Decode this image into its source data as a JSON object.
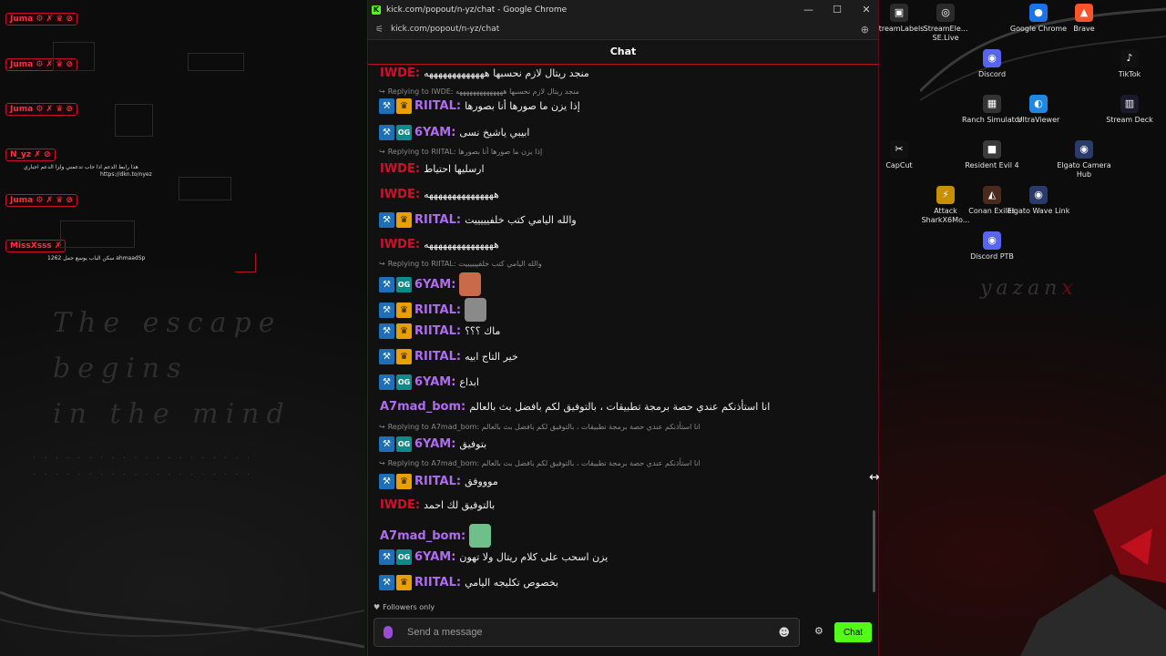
{
  "browser": {
    "window_title": "kick.com/popout/n-yz/chat - Google Chrome",
    "url": "kick.com/popout/n-yz/chat",
    "controls": {
      "minimize": "—",
      "maximize": "☐",
      "close": "✕"
    }
  },
  "chat": {
    "header": "Chat",
    "messages": [
      {
        "user": "IWDE",
        "color": "#d0102a",
        "badges": [],
        "text": "منجد ريتال لازم نحسبها هههههههههههههه"
      },
      {
        "reply": "Replying to IWDE: منجد ريتال لازم نحسبها ههههههههههههههه"
      },
      {
        "user": "RIITAL",
        "color": "#b06cf0",
        "badges": [
          "mod",
          "crown"
        ],
        "text": "إذا يزن ما صورها أنا بصورها"
      },
      {
        "user": "6YAM",
        "color": "#b06cf0",
        "badges": [
          "mod",
          "og"
        ],
        "text": "ابيبي ياشيخ نسى"
      },
      {
        "reply": "Replying to RIITAL: إذا يزن ما صورها أنا بصورها"
      },
      {
        "user": "IWDE",
        "color": "#d0102a",
        "badges": [],
        "text": "ارسليها احتياط"
      },
      {
        "user": "IWDE",
        "color": "#d0102a",
        "badges": [],
        "text": "هههههههههههههههه"
      },
      {
        "user": "RIITAL",
        "color": "#b06cf0",
        "badges": [
          "mod",
          "crown"
        ],
        "text": "والله اليامي كتب خلفيييييت"
      },
      {
        "user": "IWDE",
        "color": "#d0102a",
        "badges": [],
        "text": "هههههههههههههههه"
      },
      {
        "reply": "Replying to RIITAL: والله اليامي كتب خلفييييييت"
      },
      {
        "user": "6YAM",
        "color": "#b06cf0",
        "badges": [
          "mod",
          "og"
        ],
        "emote": "emote-hand"
      },
      {
        "user": "RIITAL",
        "color": "#b06cf0",
        "badges": [
          "mod",
          "crown"
        ],
        "emote": "emote-cat"
      },
      {
        "user": "RIITAL",
        "color": "#b06cf0",
        "badges": [
          "mod",
          "crown"
        ],
        "text": "ماك ؟؟؟"
      },
      {
        "user": "RIITAL",
        "color": "#b06cf0",
        "badges": [
          "mod",
          "crown"
        ],
        "text": "خير التاج ابيه"
      },
      {
        "user": "6YAM",
        "color": "#b06cf0",
        "badges": [
          "mod",
          "og"
        ],
        "text": "ابداع"
      },
      {
        "user": "A7mad_bom",
        "color": "#b06cf0",
        "badges": [],
        "text": "انا استأذنكم عندي حصة برمجة تطبيقات ، بالتوفيق لكم بافضل بث بالعالم"
      },
      {
        "reply": "Replying to A7mad_bom: انا استأذنكم عندي حصة برمجة تطبيقات ، بالتوفيق لكم بافضل بث بالعالم"
      },
      {
        "user": "6YAM",
        "color": "#b06cf0",
        "badges": [
          "mod",
          "og"
        ],
        "text": "بتوفيق"
      },
      {
        "reply": "Replying to A7mad_bom: انا استأذنكم عندي حصة برمجة تطبيقات ، بالتوفيق لكم بافضل بث بالعالم"
      },
      {
        "user": "RIITAL",
        "color": "#b06cf0",
        "badges": [
          "mod",
          "crown"
        ],
        "text": "موووفق"
      },
      {
        "user": "IWDE",
        "color": "#d0102a",
        "badges": [],
        "text": "بالتوفيق لك احمد"
      },
      {
        "user": "A7mad_bom",
        "color": "#b06cf0",
        "badges": [],
        "emote": "emote-green"
      },
      {
        "user": "6YAM",
        "color": "#b06cf0",
        "badges": [
          "mod",
          "og"
        ],
        "text": "يزن اسحب على كلام ريتال ولا تهون"
      },
      {
        "user": "RIITAL",
        "color": "#b06cf0",
        "badges": [
          "mod",
          "crown"
        ],
        "text": "بخصوص تكليجه اليامي"
      }
    ],
    "followers_only": "Followers only",
    "input_placeholder": "Send a message",
    "send_button": "Chat"
  },
  "desktop": {
    "icons": [
      {
        "label": "StreamLabels",
        "color": "#2b2b2b",
        "glyph": "▣"
      },
      {
        "label": "StreamEle... SE.Live",
        "color": "#2b2b2b",
        "glyph": "◎"
      },
      {
        "label": "Google Chrome",
        "color": "#1a73e8",
        "glyph": "●"
      },
      {
        "label": "Brave",
        "color": "#fb542b",
        "glyph": "▲"
      },
      {
        "label": "Discord",
        "color": "#5865f2",
        "glyph": "◉"
      },
      {
        "label": "TikTok",
        "color": "#111111",
        "glyph": "♪"
      },
      {
        "label": "Ranch Simulator",
        "color": "#333333",
        "glyph": "▦"
      },
      {
        "label": "UltraViewer",
        "color": "#1e88e5",
        "glyph": "◐"
      },
      {
        "label": "Stream Deck",
        "color": "#1a1a2a",
        "glyph": "▥"
      },
      {
        "label": "CapCut",
        "color": "#111111",
        "glyph": "✂"
      },
      {
        "label": "Resident Evil 4",
        "color": "#3a3a3a",
        "glyph": "■"
      },
      {
        "label": "Elgato Camera Hub",
        "color": "#2a3a6a",
        "glyph": "◉"
      },
      {
        "label": "Attack SharkX6Mo...",
        "color": "#c89000",
        "glyph": "⚡"
      },
      {
        "label": "Conan Exiles",
        "color": "#4a2a1a",
        "glyph": "◭"
      },
      {
        "label": "Elgato Wave Link",
        "color": "#2a3a6a",
        "glyph": "◉"
      },
      {
        "label": "Discord PTB",
        "color": "#5865f2",
        "glyph": "◉"
      }
    ]
  },
  "overlay": {
    "tags": [
      "Juma ⚙ ✗ ♛ ⊘",
      "Juma ⚙ ✗ ♛ ⊘",
      "Juma ⚙ ✗ ♛ ⊘",
      "N_yz ✗ ⊘",
      "Juma ⚙ ✗ ♛ ⊘",
      "MissXsss ✗"
    ],
    "note1": "هذا رابط الدعم اذا حاب تدعمني ولزا الدعم اجباري",
    "note1_link": "https://dkn.to/nyez",
    "note2": "ahmaadSp سكن الباب يوسع جمل 1262",
    "escape_lines": [
      "The escape",
      "begins",
      "in the mind"
    ],
    "logo": "yazan",
    "logo_mark": "x"
  }
}
